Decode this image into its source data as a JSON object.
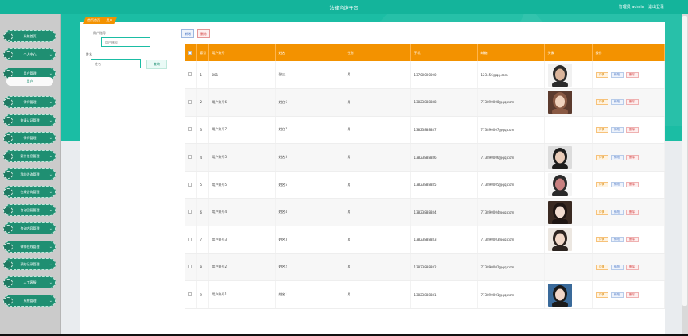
{
  "header": {
    "title": "法律咨询平台",
    "welcome": "管理员 admin",
    "logout": "退出登录",
    "accent": "#14b49b"
  },
  "sidebar": {
    "items": [
      {
        "label": "系统首页"
      },
      {
        "label": "个人中心"
      },
      {
        "label": "用户管理"
      },
      {
        "label": "律师管理"
      },
      {
        "label": "申请认证管理"
      },
      {
        "label": "律师管理"
      },
      {
        "label": "案件信息管理"
      },
      {
        "label": "我的咨询管理"
      },
      {
        "label": "在线咨询管理"
      },
      {
        "label": "咨询回复管理"
      },
      {
        "label": "咨询内容管理"
      },
      {
        "label": "律师在线管理"
      },
      {
        "label": "预约记录管理"
      },
      {
        "label": "人工客服"
      },
      {
        "label": "系统管理"
      }
    ],
    "active_sub": "用户"
  },
  "breadcrumb": {
    "home": "首页首页",
    "sep": "|",
    "current": "用户"
  },
  "filters": {
    "account_label": "用户账号",
    "account_placeholder": "用户账号",
    "name_label": "姓名",
    "name_placeholder": "姓名",
    "search_button": "查询"
  },
  "toolbar": {
    "add": "新增",
    "delete": "删除"
  },
  "table": {
    "columns": [
      "",
      "索引",
      "用户账号",
      "姓名",
      "性别",
      "手机",
      "邮箱",
      "头像",
      "操作"
    ],
    "ops": {
      "detail": "详情",
      "edit": "修改",
      "remove": "删除"
    },
    "rows": [
      {
        "index": "1",
        "account": "001",
        "name": "张三",
        "gender": "男",
        "phone": "13700000000",
        "email": "123456@qq.com",
        "avatar": "avatar-man"
      },
      {
        "index": "2",
        "account": "用户账号6",
        "name": "姓名6",
        "gender": "男",
        "phone": "13823888888",
        "email": "773890008@qq.com",
        "avatar": "avatar-woman-short-hair"
      },
      {
        "index": "3",
        "account": "用户账号7",
        "name": "姓名7",
        "gender": "男",
        "phone": "13823888887",
        "email": "773890007@qq.com",
        "avatar": ""
      },
      {
        "index": "4",
        "account": "用户账号5",
        "name": "姓名5",
        "gender": "男",
        "phone": "13823888886",
        "email": "773890006@qq.com",
        "avatar": "avatar-woman-long-hair"
      },
      {
        "index": "5",
        "account": "用户账号5",
        "name": "姓名5",
        "gender": "男",
        "phone": "13823888885",
        "email": "773890005@qq.com",
        "avatar": "avatar-woman-side"
      },
      {
        "index": "6",
        "account": "用户账号4",
        "name": "姓名4",
        "gender": "男",
        "phone": "13823888884",
        "email": "773890004@qq.com",
        "avatar": "avatar-woman-dark"
      },
      {
        "index": "7",
        "account": "用户账号3",
        "name": "姓名3",
        "gender": "男",
        "phone": "13823888883",
        "email": "773890003@qq.com",
        "avatar": "avatar-woman-portrait"
      },
      {
        "index": "8",
        "account": "用户账号2",
        "name": "姓名2",
        "gender": "男",
        "phone": "13823888882",
        "email": "773890002@qq.com",
        "avatar": ""
      },
      {
        "index": "9",
        "account": "用户账号1",
        "name": "姓名1",
        "gender": "男",
        "phone": "13823888881",
        "email": "773890001@qq.com",
        "avatar": "avatar-woman-blue"
      }
    ]
  }
}
